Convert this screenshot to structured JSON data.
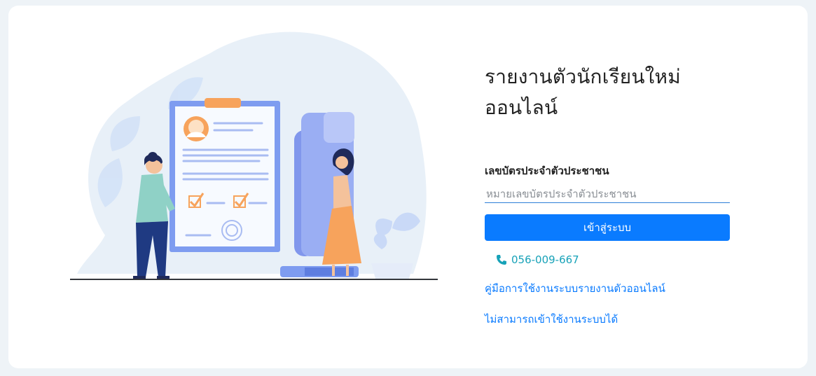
{
  "login": {
    "title": "รายงานตัวนักเรียนใหม่ออนไลน์",
    "id_label": "เลขบัตรประจำตัวประชาชน",
    "id_placeholder": "หมายเลขบัตรประจำตัวประชาชน",
    "id_value": "",
    "submit_label": "เข้าสู่ระบบ"
  },
  "contact": {
    "phone": "056-009-667",
    "phone_icon": "phone-icon"
  },
  "links": {
    "manual": "คู่มือการใช้งานระบบรายงานตัวออนไลน์",
    "cannot_login": "ไม่สามารถเข้าใช้งานระบบได้"
  },
  "colors": {
    "accent": "#0a7bff",
    "phone": "#17a2b8",
    "background": "#eef3f7"
  }
}
